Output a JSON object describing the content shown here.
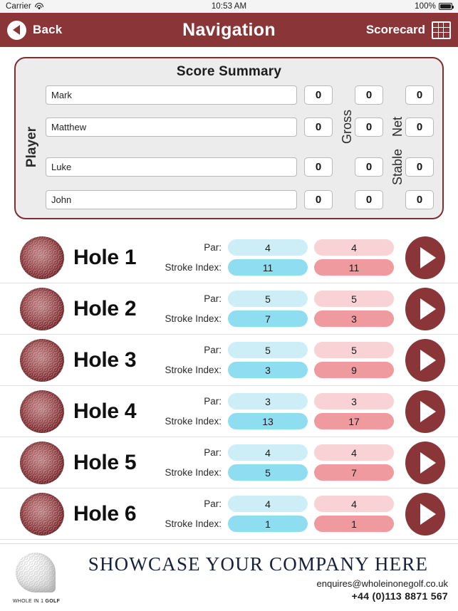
{
  "status_bar": {
    "carrier": "Carrier",
    "wifi_icon": "wifi-icon",
    "time": "10:53 AM",
    "battery_percent": "100%",
    "battery_icon": "battery-full-icon"
  },
  "nav": {
    "back_label": "Back",
    "back_icon": "back-circle-arrow-icon",
    "title": "Navigation",
    "scorecard_label": "Scorecard",
    "scorecard_icon": "grid-icon",
    "background_color": "#8a3639"
  },
  "summary": {
    "title": "Score Summary",
    "player_label": "Player",
    "gross_label": "Gross",
    "net_label": "Net",
    "stable_label": "Stable",
    "rows": [
      {
        "name": "Mark",
        "gross": "0",
        "net": "0",
        "stable": "0"
      },
      {
        "name": "Matthew",
        "gross": "0",
        "net": "0",
        "stable": "0"
      },
      {
        "name": "Luke",
        "gross": "0",
        "net": "0",
        "stable": "0"
      },
      {
        "name": "John",
        "gross": "0",
        "net": "0",
        "stable": "0"
      }
    ]
  },
  "holes": {
    "par_label": "Par:",
    "stroke_index_label": "Stroke Index:",
    "ball_icon": "golf-ball-icon",
    "play_icon": "play-arrow-icon",
    "items": [
      {
        "name": "Hole 1",
        "par_blue": "4",
        "si_blue": "11",
        "par_pink": "4",
        "si_pink": "11"
      },
      {
        "name": "Hole 2",
        "par_blue": "5",
        "si_blue": "7",
        "par_pink": "5",
        "si_pink": "3"
      },
      {
        "name": "Hole 3",
        "par_blue": "5",
        "si_blue": "3",
        "par_pink": "5",
        "si_pink": "9"
      },
      {
        "name": "Hole 4",
        "par_blue": "3",
        "si_blue": "13",
        "par_pink": "3",
        "si_pink": "17"
      },
      {
        "name": "Hole 5",
        "par_blue": "4",
        "si_blue": "5",
        "par_pink": "4",
        "si_pink": "7"
      },
      {
        "name": "Hole 6",
        "par_blue": "4",
        "si_blue": "1",
        "par_pink": "4",
        "si_pink": "1"
      }
    ],
    "colors": {
      "par_blue": "#cdeef6",
      "stroke_index_blue": "#8eddf0",
      "par_pink": "#f8d2d5",
      "stroke_index_pink": "#ef9a9e"
    }
  },
  "footer": {
    "logo_icon": "golf-ball-logo-icon",
    "logo_text_plain": "WHOLE IN 1 ",
    "logo_text_bold": "GOLF",
    "headline": "SHOWCASE YOUR COMPANY HERE",
    "email": "enquires@wholeinonegolf.co.uk",
    "phone": "+44 (0)113 8871 567"
  }
}
